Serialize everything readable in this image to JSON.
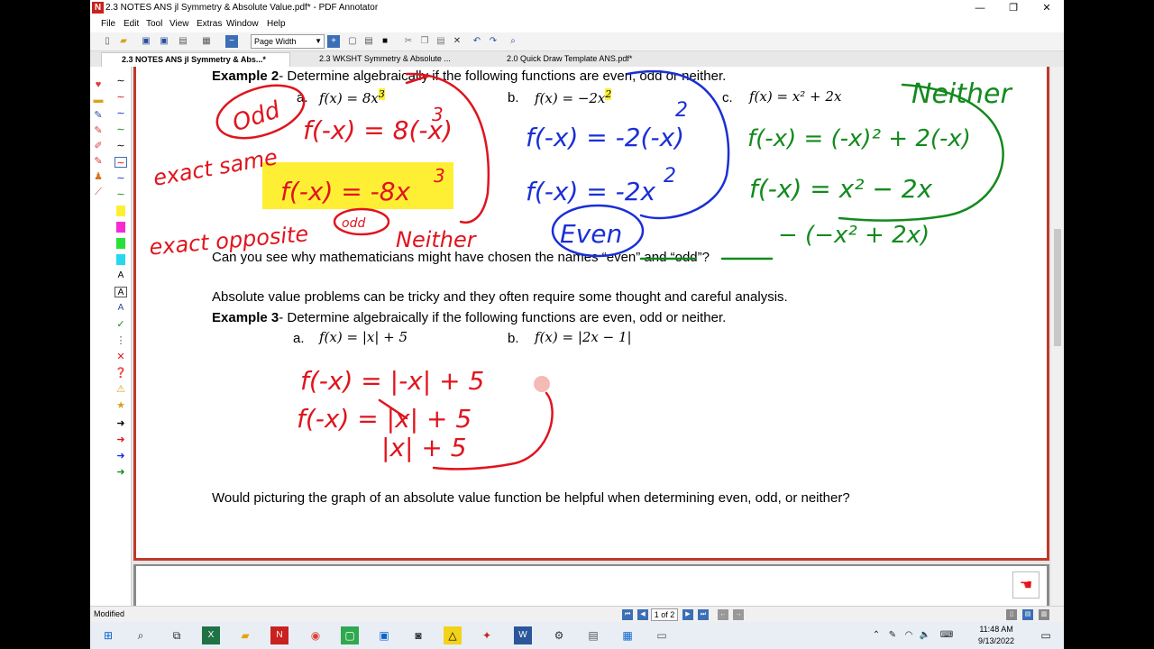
{
  "window": {
    "title": "2.3 NOTES ANS jl Symmetry & Absolute Value.pdf* - PDF Annotator",
    "app_icon": "N",
    "buttons": {
      "minimize": "—",
      "restore": "❐",
      "close": "✕"
    }
  },
  "menu": [
    "File",
    "Edit",
    "Tool",
    "View",
    "Extras",
    "Window",
    "Help"
  ],
  "toolbar": {
    "zoom": "Page Width"
  },
  "tabs": [
    {
      "label": "2.3 NOTES ANS jl Symmetry & Abs...*",
      "active": true
    },
    {
      "label": "2.3 WKSHT Symmetry & Absolute ...",
      "active": false
    },
    {
      "label": "2.0 Quick Draw Template ANS.pdf*",
      "active": false
    }
  ],
  "document": {
    "example2_label": "Example 2",
    "example2_text": "- Determine algebraically if the following functions are even, odd or neither.",
    "ex2_a_letter": "a.",
    "ex2_a_lhs": "f(x) = 8x",
    "ex2_a_exp": "3",
    "ex2_b_letter": "b.",
    "ex2_b_lhs": "f(x) = −2x",
    "ex2_b_exp": "2",
    "ex2_c_letter": "c.",
    "ex2_c_expr": "f(x) = x² + 2x",
    "question1": "Can you see why mathematicians might have chosen the names “even” and “odd”?",
    "absolute_intro": "Absolute value problems can be tricky and they often require some thought and careful analysis.",
    "example3_label": "Example 3",
    "example3_text": "- Determine algebraically if the following functions are even, odd or neither.",
    "ex3_a_letter": "a.",
    "ex3_a_expr": "f(x) = |x| + 5",
    "ex3_b_letter": "b.",
    "ex3_b_expr": "f(x) = |2x − 1|",
    "question2": "Would picturing the graph of an absolute value function be helpful when determining even, odd, or neither?"
  },
  "annotations": {
    "odd": "Odd",
    "odd_small": "odd",
    "ex2_a_work": "f(-x) = 8(-x)",
    "ex2_a_work_exp": "3",
    "ex2_a_result": "f(-x) = -8x",
    "ex2_a_result_exp": "3",
    "exact_same": "exact same",
    "exact_opposite": "exact opposite",
    "neither_small": "Neither",
    "ex2_b_work": "f(-x) = -2(-x)",
    "ex2_b_work_exp": "2",
    "ex2_b_result": "f(-x) = -2x",
    "ex2_b_result_exp": "2",
    "even": "Even",
    "neither_big": "Neither",
    "ex2_c_work": "f(-x) = (-x)² + 2(-x)",
    "ex2_c_result": "f(-x) = x² − 2x",
    "ex2_c_neg": "− (−x² + 2x)",
    "ex3_a_work": "f(-x) = |-x| + 5",
    "ex3_a_work2": "f(-x) = |x| + 5",
    "ex3_a_work3": "|x| + 5"
  },
  "status": {
    "modified": "Modified",
    "page": "1 of 2"
  },
  "taskbar": {
    "time": "11:48 AM",
    "date": "9/13/2022"
  },
  "colors": {
    "red_ink": "#e0141e",
    "blue_ink": "#1a2fd6",
    "green_ink": "#138a1e",
    "highlight": "#ffef34"
  }
}
